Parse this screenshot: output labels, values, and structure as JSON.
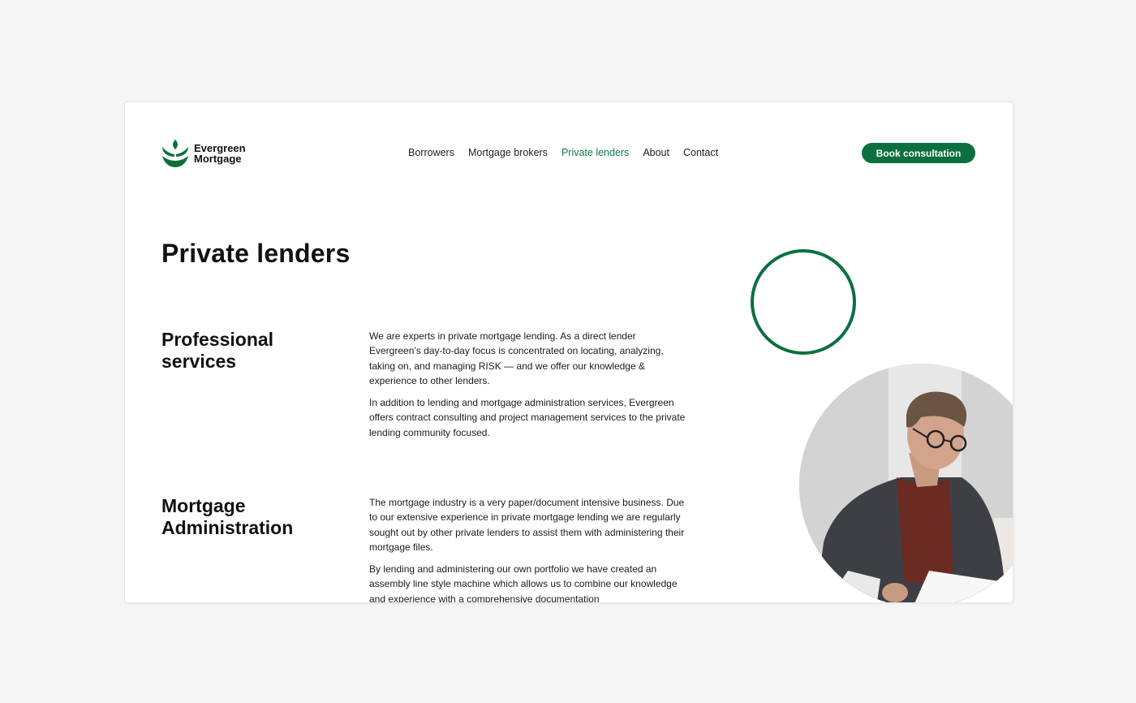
{
  "brand": {
    "name_line1": "Evergreen",
    "name_line2": "Mortgage",
    "color": "#0c6f3f"
  },
  "nav": {
    "items": [
      {
        "label": "Borrowers",
        "active": false
      },
      {
        "label": "Mortgage brokers",
        "active": false
      },
      {
        "label": "Private lenders",
        "active": true
      },
      {
        "label": "About",
        "active": false
      },
      {
        "label": "Contact",
        "active": false
      }
    ],
    "cta_label": "Book consultation"
  },
  "page": {
    "title": "Private lenders"
  },
  "sections": [
    {
      "title": "Professional services",
      "paragraphs": [
        "We are experts in private mortgage lending. As a direct lender Evergreen’s day-to-day focus is concentrated on locating, analyzing, taking on, and managing RISK — and we offer our knowledge & experience to other lenders.",
        "In addition to lending and mortgage administration services, Evergreen offers contract consulting and project management services to the private lending community focused."
      ]
    },
    {
      "title": "Mortgage Administration",
      "paragraphs": [
        "The mortgage industry is a very paper/document intensive business. Due to our extensive experience in private mortgage lending we are regularly sought out by other private lenders to assist them with administering their mortgage files.",
        "By lending and administering our own portfolio we have created an assembly line style machine which allows us to combine our knowledge and experience with a comprehensive documentation"
      ]
    }
  ],
  "decor": {
    "ring_icon": "circle-outline-icon",
    "photo": "man-reading-documents-photo"
  }
}
